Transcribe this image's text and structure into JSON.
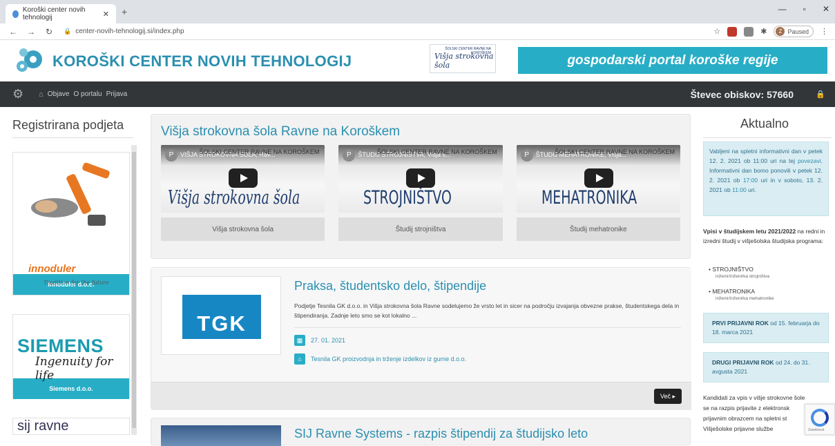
{
  "browser": {
    "tab_title": "Koroški center novih tehnologij",
    "url": "center-novih-tehnologij.si/index.php",
    "profile_status": "Paused",
    "profile_initial": "Z"
  },
  "header": {
    "site_title": "KOROŠKI CENTER NOVIH TEHNOLOGIJ",
    "school_logo_top": "ŠOLSKI CENTER RAVNE NA KOROŠKEM",
    "school_logo_text": "Višja strokovna šola",
    "portal_button": "gospodarski portal koroške regije"
  },
  "nav": {
    "items": [
      "Objave",
      "O portalu",
      "Prijava"
    ],
    "counter": "Števec obiskov: 57660"
  },
  "left": {
    "title": "Registrirana podjeta",
    "companies": [
      {
        "name": "Innoduler d.o.o.",
        "logo": "innoduler",
        "tagline": "Tradition for the future"
      },
      {
        "name": "Siemens d.o.o.",
        "logo": "SIEMENS",
        "tagline": "Ingenuity for life"
      },
      {
        "name": "SIJ Ravne",
        "logo": "sij ravne"
      }
    ]
  },
  "main": {
    "section_title": "Višja strokovna šola Ravne na Koroškem",
    "videos": [
      {
        "title": "VIŠJA STROKOVNA ŠOLA, Rav...",
        "school": "ŠOLSKI CENTER RAVNE NA KOROŠKEM",
        "big": "Višja strokovna šola",
        "label": "Višja strokovna šola"
      },
      {
        "title": "ŠTUDIJ STROJNIŠTVA, Višja s...",
        "school": "ŠOLSKI CENTER RAVNE NA KOROŠKEM",
        "big": "STROJNIŠTVO",
        "label": "Študij strojništva"
      },
      {
        "title": "ŠTUDIJ MEHATRONIKE, Višja...",
        "school": "ŠOLSKI CENTER RAVNE NA KOROŠKEM",
        "big": "MEHATRONIKA",
        "label": "Študij mehatronike"
      }
    ],
    "post1": {
      "title": "Praksa, študentsko delo, štipendije",
      "text": "Podjetje Tesnila GK d.o.o. in Višja strokovna šola Ravne sodelujemo že vrsto let in sicer na področju izvajanja obvezne prakse, študentskega dela in štipendiranja. Zadnje leto smo se kot lokalno ...",
      "logo": "TGK",
      "date": "27. 01. 2021",
      "company": "Tesnila GK proizvodnja in trženje izdelkov iz gume d.o.o.",
      "more": "Več ▸"
    },
    "post2": {
      "title": "SIJ Ravne Systems - razpis štipendij za študijsko leto"
    }
  },
  "right": {
    "title": "Aktualno",
    "info": {
      "text1": "Vabljeni na spletni informativni dan v petek 12. 2. 2021 ob 11:00 uri na tej ",
      "link1": "povezavi",
      "text2": ". Informativni dan bomo ponovili v petek 12. 2. 2021 ob ",
      "time1": "17:00",
      "text3": " uri in v soboto, 13. 2. 2021 ob ",
      "time2": "11:00",
      "text4": " uri."
    },
    "vpisi_bold": "Vpisi v študijskem letu 2021/2022",
    "vpisi_rest": " na redni in izredni študij v višješolska študijska programa:",
    "programs": [
      {
        "name": "STROJNIŠTVO",
        "sub": "inženir/inženirka strojništva"
      },
      {
        "name": "MEHATRONIKA",
        "sub": "inženir/inženirka mehatronike"
      }
    ],
    "rok1_bold": "PRVI PRIJAVNI ROK",
    "rok1_rest": " od 15. februarja do 18. marca 2021",
    "rok2_bold": "DRUGI PRIJAVNI ROK",
    "rok2_rest": " od 24. do 31. avgusta 2021",
    "kandidati": "Kandidati za vpis v višje strokovne šole se na razpis prijavite z elektronsk prijavnim obrazcem na spletni st Višješolske prijavne službe"
  }
}
